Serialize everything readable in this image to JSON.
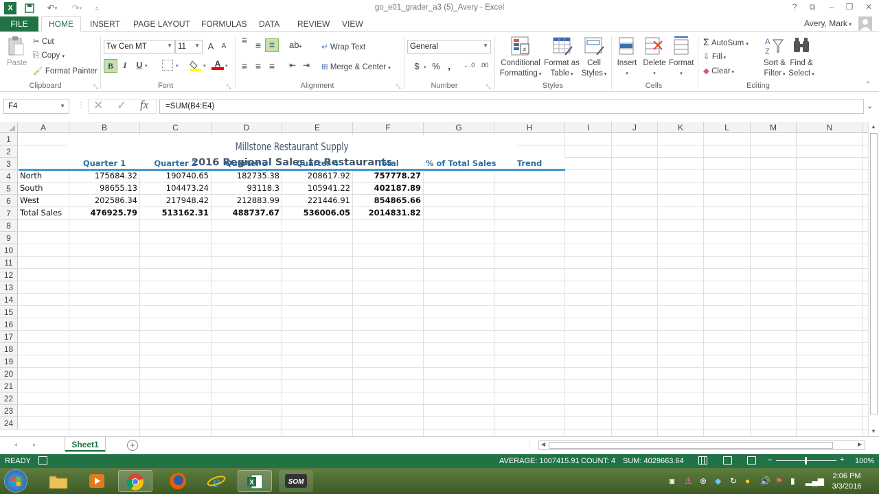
{
  "window": {
    "title": "go_e01_grader_a3 (5)_Avery - Excel",
    "help": "?",
    "restore_ribbon": "⧉",
    "minimize": "–",
    "maximize": "❐",
    "close": "✕"
  },
  "user": {
    "name": "Avery, Mark"
  },
  "tabs": {
    "file": "FILE",
    "home": "HOME",
    "insert": "INSERT",
    "page_layout": "PAGE LAYOUT",
    "formulas": "FORMULAS",
    "data": "DATA",
    "review": "REVIEW",
    "view": "VIEW"
  },
  "ribbon": {
    "clipboard": {
      "paste": "Paste",
      "cut": "Cut",
      "copy": "Copy",
      "format_painter": "Format Painter",
      "label": "Clipboard"
    },
    "font": {
      "name": "Tw Cen MT",
      "size": "11",
      "grow": "A",
      "shrink": "A",
      "bold": "B",
      "italic": "I",
      "underline": "U",
      "label": "Font"
    },
    "alignment": {
      "wrap": "Wrap Text",
      "merge": "Merge & Center",
      "label": "Alignment"
    },
    "number": {
      "format": "General",
      "currency": "$",
      "percent": "%",
      "comma": ",",
      "inc": "←.0",
      "dec": ".00",
      "label": "Number"
    },
    "styles": {
      "conditional": [
        "Conditional",
        "Formatting"
      ],
      "table": [
        "Format as",
        "Table"
      ],
      "cell": [
        "Cell",
        "Styles"
      ],
      "label": "Styles"
    },
    "cells": {
      "insert": "Insert",
      "delete": "Delete",
      "format": "Format",
      "label": "Cells"
    },
    "editing": {
      "autosum": "AutoSum",
      "fill": "Fill",
      "clear": "Clear",
      "sort": [
        "Sort &",
        "Filter"
      ],
      "find": [
        "Find &",
        "Select"
      ],
      "label": "Editing"
    }
  },
  "formula_bar": {
    "name_box": "F4",
    "cancel": "✕",
    "enter": "✓",
    "fx": "fx",
    "formula": "=SUM(B4:E4)"
  },
  "columns": [
    "A",
    "B",
    "C",
    "D",
    "E",
    "F",
    "G",
    "H",
    "I",
    "J",
    "K",
    "L",
    "M",
    "N"
  ],
  "rows": [
    "1",
    "2",
    "3",
    "4",
    "5",
    "6",
    "7",
    "8",
    "9",
    "10",
    "11",
    "12",
    "13",
    "14",
    "15",
    "16",
    "17",
    "18",
    "19",
    "20",
    "21",
    "22",
    "23",
    "24"
  ],
  "sheet": {
    "title": "Millstone Restaurant Supply",
    "subtitle": "2016 Regional Sales to Restaurants",
    "headers": [
      "Quarter 1",
      "Quarter 2",
      "Quarter 3",
      "Quarter 4",
      "Total",
      "% of Total Sales",
      "Trend"
    ],
    "data_rows": [
      {
        "label": "North",
        "values": [
          "175684.32",
          "190740.65",
          "182735.38",
          "208617.92",
          "757778.27"
        ]
      },
      {
        "label": "South",
        "values": [
          "98655.13",
          "104473.24",
          "93118.3",
          "105941.22",
          "402187.89"
        ]
      },
      {
        "label": "West",
        "values": [
          "202586.34",
          "217948.42",
          "212883.99",
          "221446.91",
          "854865.66"
        ]
      }
    ],
    "total_row": {
      "label": "Total Sales",
      "values": [
        "476925.79",
        "513162.31",
        "488737.67",
        "536006.05",
        "2014831.82"
      ]
    }
  },
  "sheet_tabs": {
    "active": "Sheet1",
    "add": "+"
  },
  "status": {
    "ready": "READY",
    "average": "AVERAGE: 1007415.91",
    "count": "COUNT: 4",
    "sum": "SUM: 4029663.64",
    "zoom": "100%"
  },
  "taskbar": {
    "time": "2:06 PM",
    "date": "3/3/2016"
  },
  "colors": {
    "excel_green": "#217346",
    "header_blue": "#2e6e9e",
    "title_slate": "#44546a"
  }
}
